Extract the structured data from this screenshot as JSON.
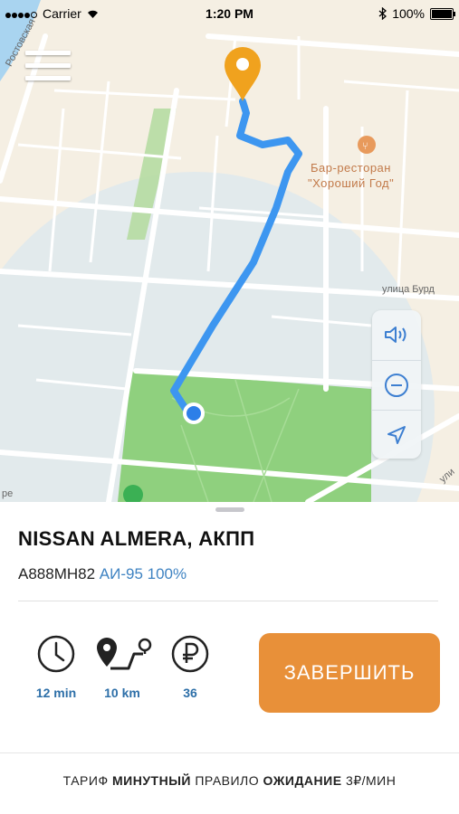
{
  "status_bar": {
    "carrier": "Carrier",
    "time": "1:20 PM",
    "battery": "100%"
  },
  "map": {
    "poi_name_line1": "Бар-ресторан",
    "poi_name_line2": "\"Хороший Год\"",
    "street_rostovskaya": "Ростовская",
    "street_burd": "улица Бурд",
    "street_uli": "ули",
    "street_fragment": "ре"
  },
  "car": {
    "title": "NISSAN ALMERA, АКПП",
    "plate": "А888МН82",
    "fuel": "АИ-95 100%"
  },
  "stats": {
    "time": "12 min",
    "distance": "10 km",
    "price": "36"
  },
  "actions": {
    "finish_label": "ЗАВЕРШИТЬ"
  },
  "tariff": {
    "label": "ТАРИФ",
    "value": "МИНУТНЫЙ",
    "rule_label": "ПРАВИЛО",
    "rule_value": "ОЖИДАНИЕ",
    "rate": "3₽/МИН"
  },
  "colors": {
    "accent": "#e89039",
    "route": "#3d96f0",
    "link": "#3f83c2"
  }
}
